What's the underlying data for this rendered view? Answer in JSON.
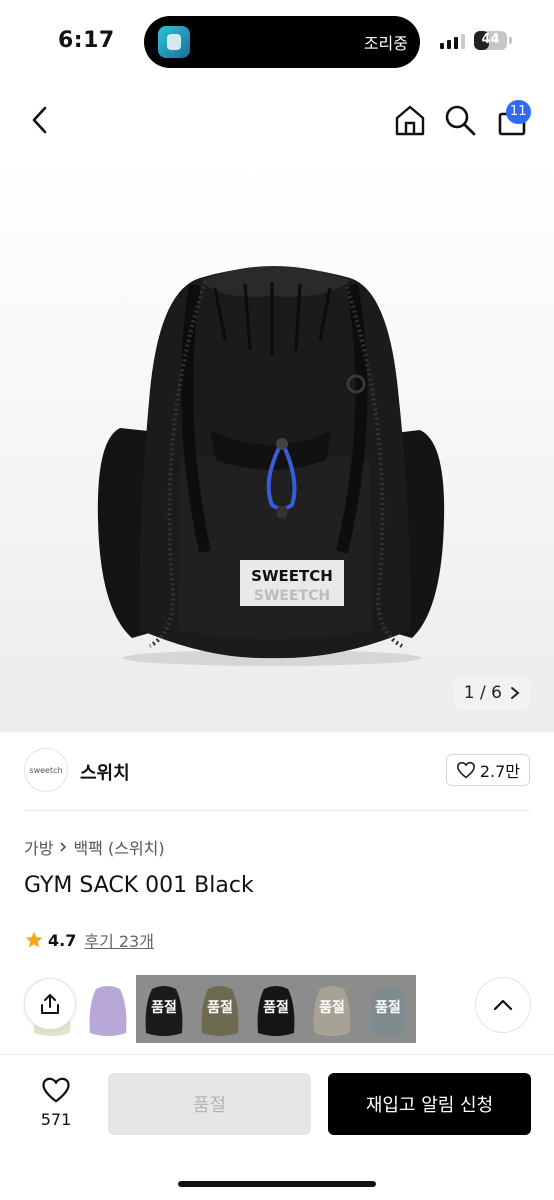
{
  "status_bar": {
    "time": "6:17",
    "live_activity_text": "조리중",
    "battery_level": "44",
    "battery_fraction": 0.44
  },
  "nav": {
    "cart_count": "11",
    "icons": [
      "chevron-left-icon",
      "home-icon",
      "search-icon",
      "shopping-bag-icon"
    ]
  },
  "gallery": {
    "current": "1",
    "separator": "/",
    "total": "6"
  },
  "brand": {
    "logo_text": "sweetch",
    "name": "스위치",
    "likes": "2.7만"
  },
  "breadcrumb": {
    "category": "가방",
    "subcategory": "백팩 (스위치)"
  },
  "product": {
    "title": "GYM SACK 001 Black",
    "rating": "4.7",
    "reviews_label": "후기 23개",
    "bag_label_top": "SWEETCH",
    "bag_label_bottom": "SWEETCH"
  },
  "options": {
    "soldout_label": "품절",
    "thumbnails": [
      {
        "color": "#dfe8c8",
        "soldout": false
      },
      {
        "color": "#b7a8d8",
        "soldout": false
      },
      {
        "color": "#1a1a1a",
        "soldout": true
      },
      {
        "color": "#6e6a52",
        "soldout": true
      },
      {
        "color": "#151515",
        "soldout": true
      },
      {
        "color": "#a8a294",
        "soldout": true
      },
      {
        "color": "#7f8c8f",
        "soldout": true
      }
    ]
  },
  "bottom": {
    "wish_count": "571",
    "soldout_button": "품절",
    "restock_button": "재입고 알림 신청"
  },
  "colors": {
    "accent": "#2f6cf5",
    "star": "#f5a623",
    "primary_button": "#000000",
    "disabled_button": "#e6e6e6"
  }
}
